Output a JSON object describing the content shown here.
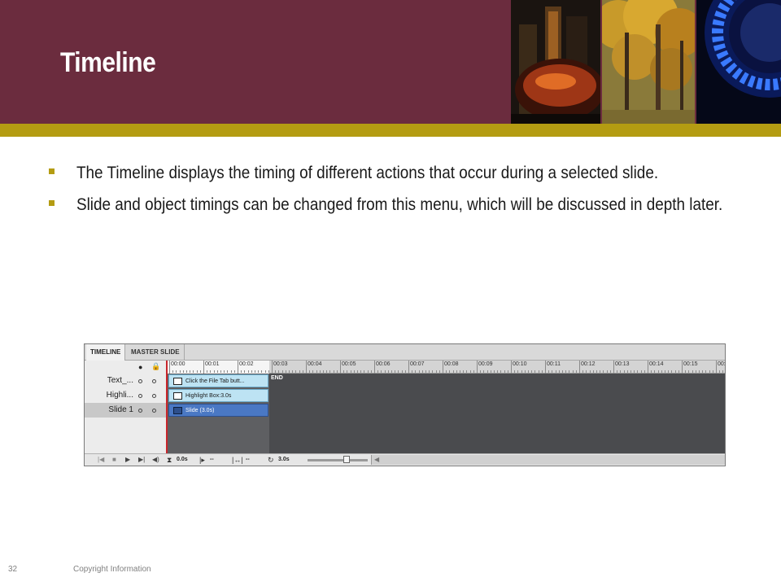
{
  "slide": {
    "title": "Timeline",
    "bullets": [
      "The Timeline displays the timing of different actions that occur during a selected slide.",
      "Slide and object timings can be changed from this menu, which will be discussed in depth later."
    ],
    "page_number": "32",
    "footer": "Copyright Information"
  },
  "colors": {
    "header": "#6b2c3e",
    "accent_band": "#b49c12",
    "bullet": "#b49c12"
  },
  "timeline": {
    "tabs": [
      "TIMELINE",
      "MASTER SLIDE"
    ],
    "active_tab": "TIMELINE",
    "header_icons": [
      "eye-icon",
      "lock-icon"
    ],
    "layers": [
      {
        "name": "Text_...",
        "selected": false
      },
      {
        "name": "Highli...",
        "selected": false
      },
      {
        "name": "Slide 1",
        "selected": true
      }
    ],
    "ruler_labels": [
      "00:00",
      "00:01",
      "00:02",
      "00:03",
      "00:04",
      "00:05",
      "00:06",
      "00:07",
      "00:08",
      "00:09",
      "00:10",
      "00:11",
      "00:12",
      "00:13",
      "00:14",
      "00:15",
      "00:"
    ],
    "bars": [
      {
        "label": "Click the File Tab butt...",
        "icon": "caption-icon"
      },
      {
        "label": "Highlight Box:3.0s",
        "icon": "highlight-box-icon"
      },
      {
        "label": "Slide (3.0s)",
        "icon": "slide-icon"
      }
    ],
    "end_label": "END",
    "playback_controls": [
      "rewind-icon",
      "stop-icon",
      "play-icon",
      "next-icon",
      "volume-icon"
    ],
    "start_time": "0.0s",
    "in_time": "--",
    "out_time": "--",
    "duration": "3.0s",
    "zoom_level": 0.65
  }
}
